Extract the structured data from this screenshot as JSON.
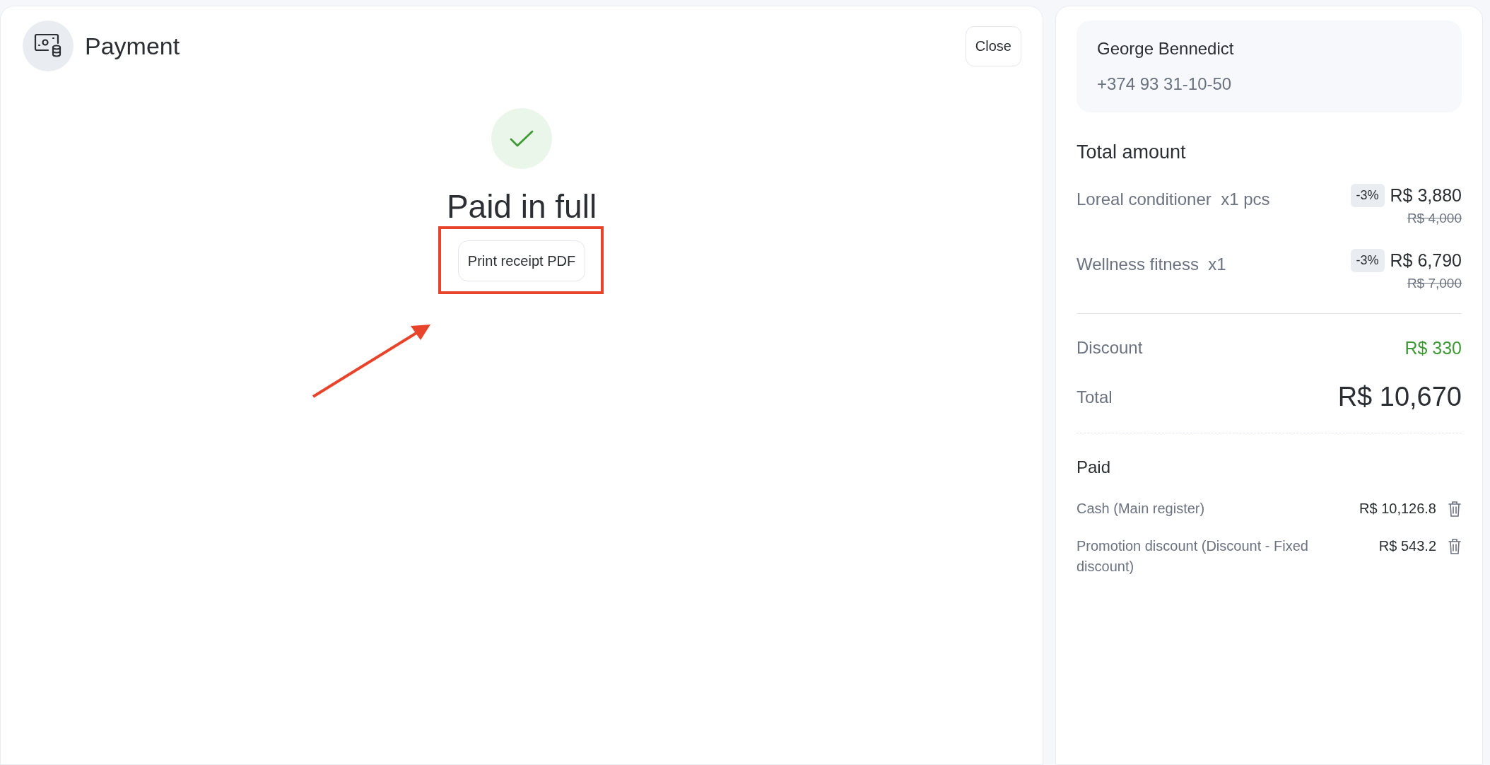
{
  "header": {
    "title": "Payment",
    "close_button": "Close"
  },
  "status": {
    "title": "Paid in full",
    "print_button": "Print receipt PDF"
  },
  "customer": {
    "name": "George Bennedict",
    "phone": "+374 93 31-10-50"
  },
  "total_amount": {
    "heading": "Total amount",
    "items": [
      {
        "name": "Loreal conditioner  x1 pcs",
        "badge": "-3%",
        "price": "R$ 3,880",
        "old_price": "R$ 4,000"
      },
      {
        "name": "Wellness fitness  x1",
        "badge": "-3%",
        "price": "R$ 6,790",
        "old_price": "R$ 7,000"
      }
    ],
    "discount_label": "Discount",
    "discount_value": "R$ 330",
    "total_label": "Total",
    "total_value": "R$ 10,670"
  },
  "paid": {
    "heading": "Paid",
    "items": [
      {
        "label": "Cash (Main register)",
        "amount": "R$ 10,126.8"
      },
      {
        "label": "Promotion discount (Discount - Fixed discount)",
        "amount": "R$ 543.2"
      }
    ]
  }
}
